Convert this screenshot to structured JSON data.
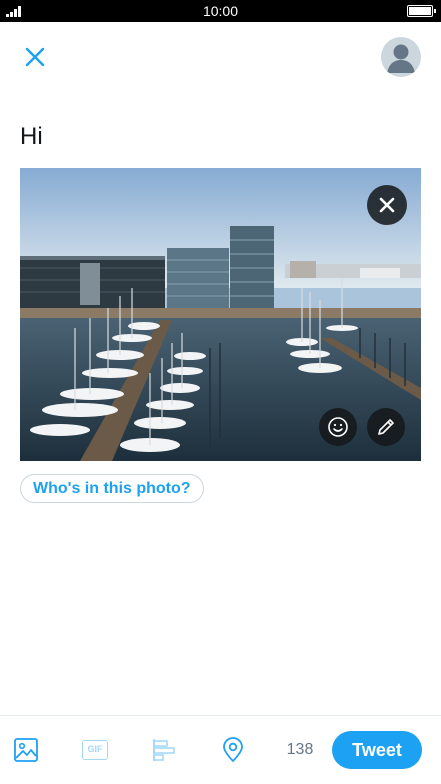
{
  "status_bar": {
    "time": "10:00",
    "signal_icon": "signal-bars-icon",
    "battery_icon": "battery-full-icon"
  },
  "header": {
    "close_icon": "close-icon",
    "avatar_icon": "default-profile-avatar"
  },
  "compose": {
    "text": "Hi"
  },
  "photo": {
    "description_icon": "harbor-marina-photo",
    "remove_icon": "close-icon",
    "sticker_icon": "smiley-icon",
    "edit_icon": "pencil-icon",
    "tag_people_label": "Who's in this photo?"
  },
  "toolbar": {
    "media_icon": "image-icon",
    "gif_label": "GIF",
    "poll_icon": "poll-icon",
    "location_icon": "location-pin-icon",
    "char_count": "138",
    "tweet_label": "Tweet"
  },
  "colors": {
    "accent": "#1da1f2",
    "accent_disabled": "#a5d8f8",
    "text_primary": "#14171a",
    "text_secondary": "#657786",
    "border": "#ccd6dd",
    "status_bar": "#000000"
  }
}
